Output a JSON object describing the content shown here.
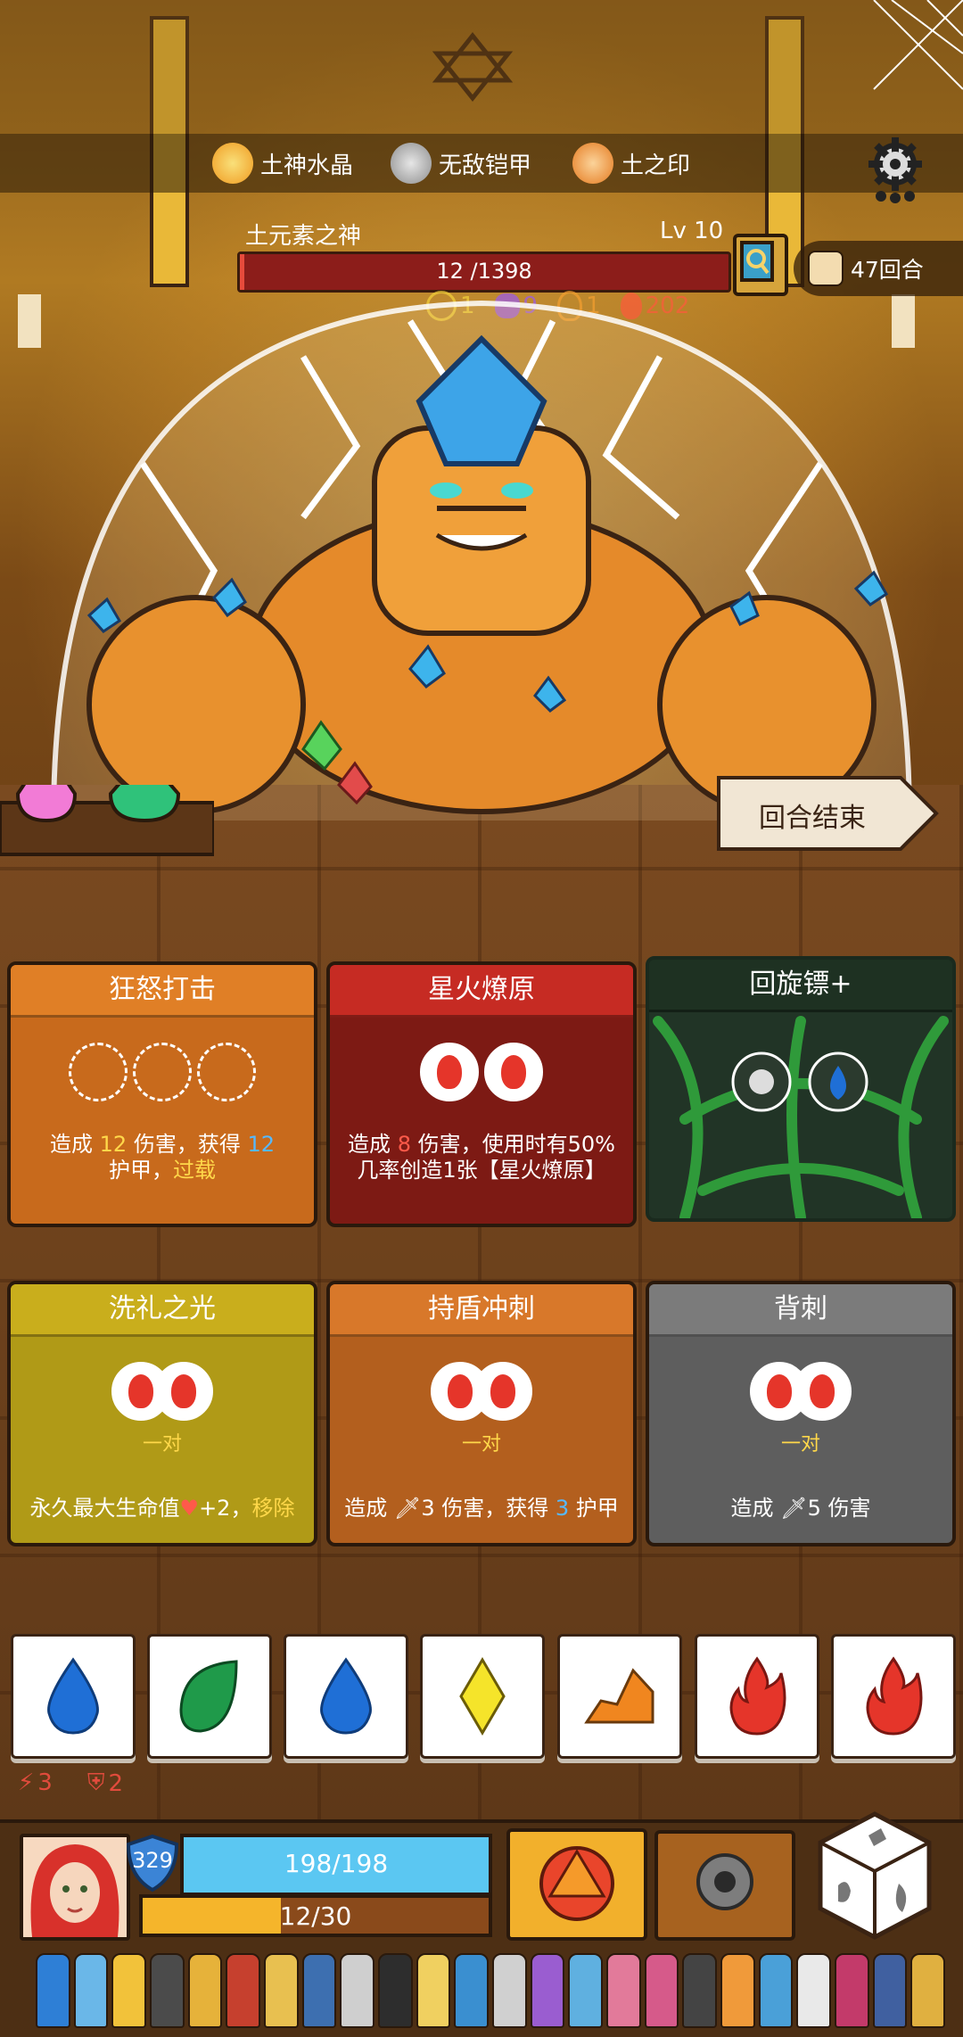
{
  "relics": [
    {
      "label": "土神水晶",
      "icon": "earth-crystal-icon",
      "color": "#f0b030"
    },
    {
      "label": "无敌铠甲",
      "icon": "armor-icon",
      "color": "#bdbdbd"
    },
    {
      "label": "土之印",
      "icon": "earth-seal-icon",
      "color": "#f09a40"
    }
  ],
  "boss": {
    "name": "土元素之神",
    "level": "Lv 10",
    "hp_text": "12 /1398",
    "hp_value": 12,
    "hp_max": 1398,
    "intents": [
      {
        "icon": "earth-icon",
        "value": "1",
        "color": "#f3d23a"
      },
      {
        "icon": "splat-icon",
        "value": "9",
        "color": "#9b59f0"
      },
      {
        "icon": "flame-outline-icon",
        "value": "1",
        "color": "#f5a030"
      },
      {
        "icon": "fire-icon",
        "value": "202",
        "color": "#ff5a3c"
      }
    ]
  },
  "rounds": "47回合",
  "end_turn": "回合结束",
  "cards_row1": [
    {
      "title": "狂怒打击",
      "color": "#c86a1c",
      "head": "#e07f26",
      "desc_a": "造成 ",
      "desc_num1": "12",
      "desc_b": " 伤害，获得 ",
      "desc_num2": "12",
      "desc_c": "护甲，",
      "desc_kw": "过载"
    },
    {
      "title": "星火燎原",
      "color": "#7d1a14",
      "head": "#c62b23",
      "desc_a": "造成 ",
      "desc_num1": "8",
      "desc_b": " 伤害，使用时有50%几率创造1张【星火燎原】"
    },
    {
      "title": "回旋镖+",
      "color": "#213426",
      "head": "#1e3122"
    }
  ],
  "cards_row2": [
    {
      "title": "洗礼之光",
      "color": "#b09a17",
      "head": "#c9ae1c",
      "pair": "一对",
      "desc_a": "永久最大生命值",
      "desc_num": "+2，",
      "desc_kw": "移除"
    },
    {
      "title": "持盾冲刺",
      "color": "#b35f1e",
      "head": "#d8782a",
      "pair": "一对",
      "desc_a": "造成 ",
      "desc_num1": "3",
      "desc_b": " 伤害，获得 ",
      "desc_num2": "3",
      "desc_c": " 护甲"
    },
    {
      "title": "背刺",
      "color": "#5e5e5e",
      "head": "#7b7b7b",
      "pair": "一对",
      "desc_a": "造成 ",
      "desc_num": "5",
      "desc_b": " 伤害"
    }
  ],
  "dice": [
    {
      "icon": "water-drop-icon",
      "color": "#1f6fd6"
    },
    {
      "icon": "leaf-icon",
      "color": "#1f9a4a"
    },
    {
      "icon": "water-drop-icon",
      "color": "#1f6fd6"
    },
    {
      "icon": "lightning-diamond-icon",
      "color": "#f5e42a"
    },
    {
      "icon": "earth-rock-icon",
      "color": "#f0861f"
    },
    {
      "icon": "fire-icon",
      "color": "#e5352a"
    },
    {
      "icon": "fire-icon",
      "color": "#e5352a"
    }
  ],
  "stats": {
    "strength": "3",
    "defense": "2"
  },
  "player": {
    "armor": "329",
    "hp_text": "198/198",
    "hp_value": 198,
    "hp_max": 198,
    "energy_text": "12/30",
    "energy_value": 12,
    "energy_max": 30
  }
}
